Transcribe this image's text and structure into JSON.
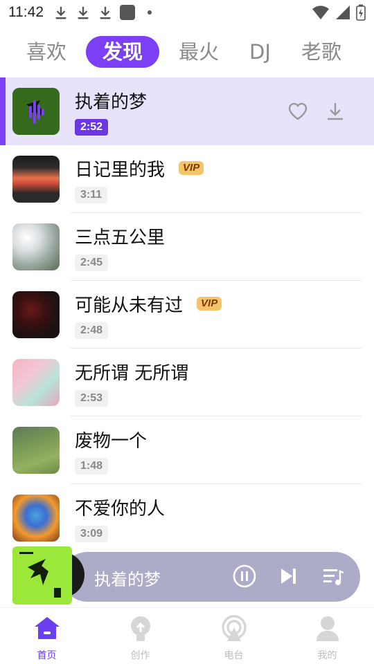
{
  "status_bar": {
    "time": "11:42"
  },
  "tabs": [
    {
      "label": "喜欢",
      "active": false
    },
    {
      "label": "发现",
      "active": true
    },
    {
      "label": "最火",
      "active": false
    },
    {
      "label": "DJ",
      "active": false
    },
    {
      "label": "老歌",
      "active": false
    }
  ],
  "songs": [
    {
      "title": "执着的梦",
      "duration": "2:52",
      "vip": false,
      "playing": true,
      "vip_label": ""
    },
    {
      "title": "日记里的我",
      "duration": "3:11",
      "vip": true,
      "playing": false,
      "vip_label": "VIP"
    },
    {
      "title": "三点五公里",
      "duration": "2:45",
      "vip": false,
      "playing": false,
      "vip_label": ""
    },
    {
      "title": "可能从未有过",
      "duration": "2:48",
      "vip": true,
      "playing": false,
      "vip_label": "VIP"
    },
    {
      "title": "无所谓 无所谓",
      "duration": "2:53",
      "vip": false,
      "playing": false,
      "vip_label": ""
    },
    {
      "title": "废物一个",
      "duration": "1:48",
      "vip": false,
      "playing": false,
      "vip_label": ""
    },
    {
      "title": "不爱你的人",
      "duration": "3:09",
      "vip": false,
      "playing": false,
      "vip_label": ""
    }
  ],
  "mini_player": {
    "title": "执着的梦"
  },
  "bottom_nav": [
    {
      "label": "首页",
      "icon": "home-icon",
      "active": true
    },
    {
      "label": "创作",
      "icon": "create-icon",
      "active": false
    },
    {
      "label": "电台",
      "icon": "radio-icon",
      "active": false
    },
    {
      "label": "我的",
      "icon": "profile-icon",
      "active": false
    }
  ],
  "colors": {
    "accent": "#7b3ff5",
    "playing_bg": "#e9e2fb",
    "mini_bar": "#acacc8",
    "vip": "#f5c46a"
  }
}
